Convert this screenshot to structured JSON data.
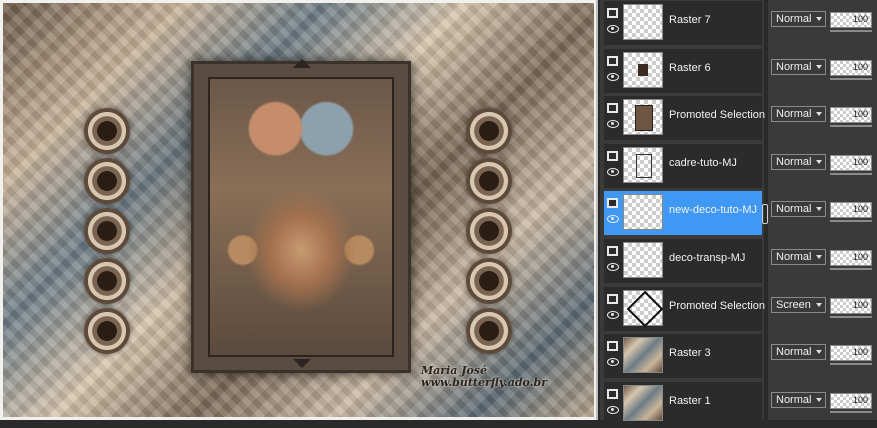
{
  "canvas": {
    "watermark_line1": "Maria José",
    "watermark_line2": "www.butterfly.ado.br"
  },
  "layers": [
    {
      "name": "Raster 7",
      "blend": "Normal",
      "opacity": "100",
      "thumb": "checker",
      "selected": false
    },
    {
      "name": "Raster 6",
      "blend": "Normal",
      "opacity": "100",
      "thumb": "small-object",
      "selected": false
    },
    {
      "name": "Promoted Selection",
      "blend": "Normal",
      "opacity": "100",
      "thumb": "framed-image",
      "selected": false
    },
    {
      "name": "cadre-tuto-MJ",
      "blend": "Normal",
      "opacity": "100",
      "thumb": "frame-outline",
      "selected": false
    },
    {
      "name": "new-deco-tuto-MJ",
      "blend": "Normal",
      "opacity": "100",
      "thumb": "checker",
      "selected": true
    },
    {
      "name": "deco-transp-MJ",
      "blend": "Normal",
      "opacity": "100",
      "thumb": "checker",
      "selected": false
    },
    {
      "name": "Promoted Selection",
      "blend": "Screen",
      "opacity": "100",
      "thumb": "diamond",
      "selected": false
    },
    {
      "name": "Raster 3",
      "blend": "Normal",
      "opacity": "100",
      "thumb": "artwork",
      "selected": false
    },
    {
      "name": "Raster 1",
      "blend": "Normal",
      "opacity": "100",
      "thumb": "artwork",
      "selected": false
    }
  ],
  "colors": {
    "panel_bg": "#3a3a3a",
    "row_bg": "#2b2b2b",
    "selected_row": "#3f98f3"
  }
}
